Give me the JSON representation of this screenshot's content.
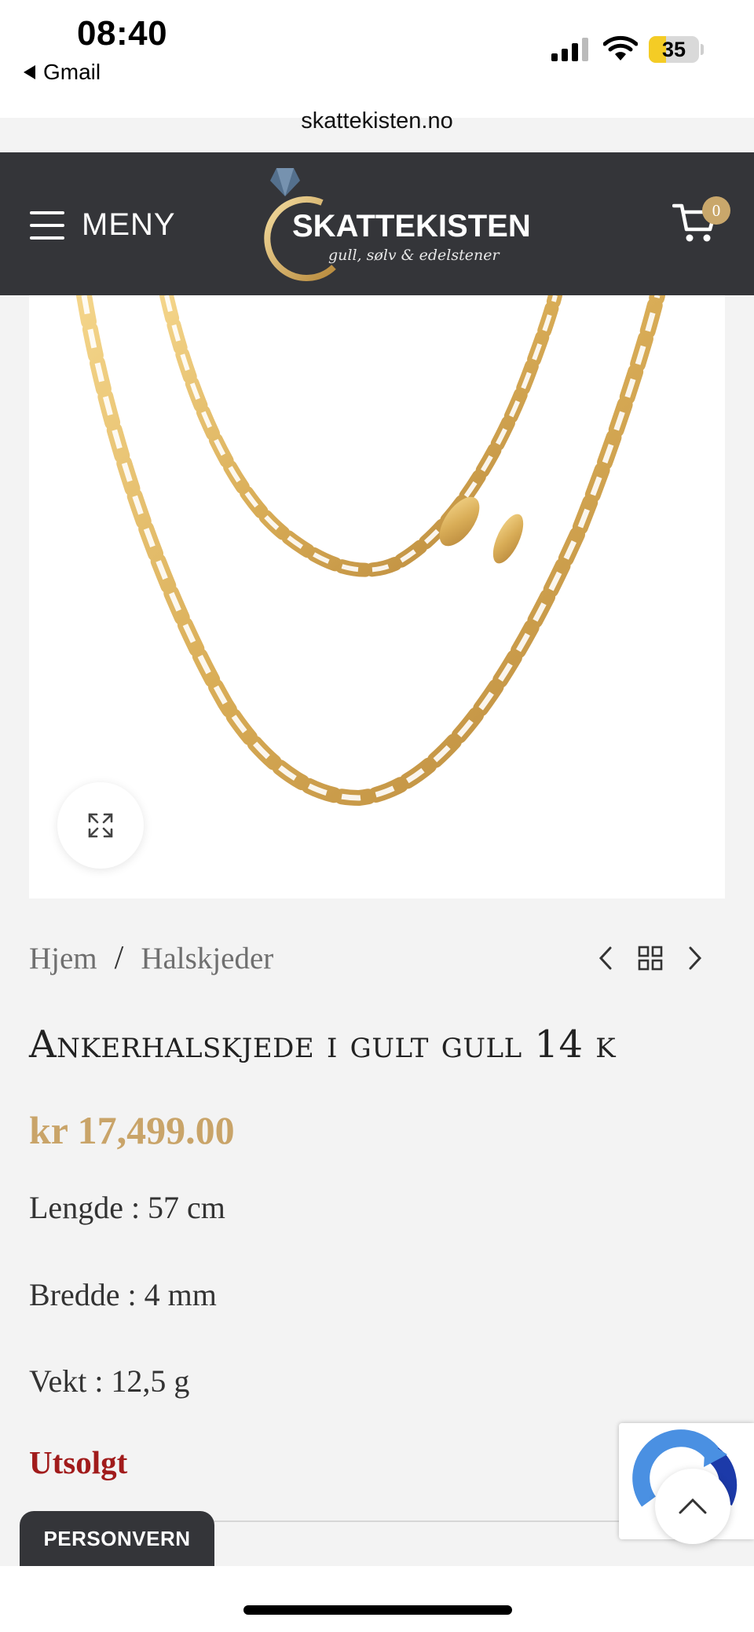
{
  "status_bar": {
    "time": "08:40",
    "back_app": "Gmail",
    "battery": "35",
    "battery_level": 0.35
  },
  "browser": {
    "url": "skattekisten.no"
  },
  "header": {
    "menu_label": "MENY",
    "logo_title": "SKATTEKISTEN",
    "logo_subtitle": "gull, sølv & edelstener",
    "cart_count": "0",
    "colors": {
      "background": "#343539",
      "accent": "#c9a76b"
    }
  },
  "breadcrumb": {
    "items": [
      "Hjem",
      "Halskjeder"
    ],
    "separator": "/"
  },
  "product": {
    "title": "Ankerhalskjede i gult gull 14 k",
    "price": "kr 17,499.00",
    "specs": [
      "Lengde : 57 cm",
      "Bredde : 4 mm",
      "Vekt : 12,5 g"
    ],
    "stock_status": "Utsolgt",
    "colors": {
      "price": "#c9a469",
      "stock": "#a11b1b"
    }
  },
  "privacy_button": "PERSONVERN",
  "icons": {
    "menu": "hamburger-icon",
    "cart": "cart-icon",
    "zoom": "expand-icon",
    "prev": "chevron-left-icon",
    "grid": "grid-icon",
    "next": "chevron-right-icon",
    "scroll_top": "chevron-up-icon",
    "recaptcha": "recaptcha-icon"
  }
}
